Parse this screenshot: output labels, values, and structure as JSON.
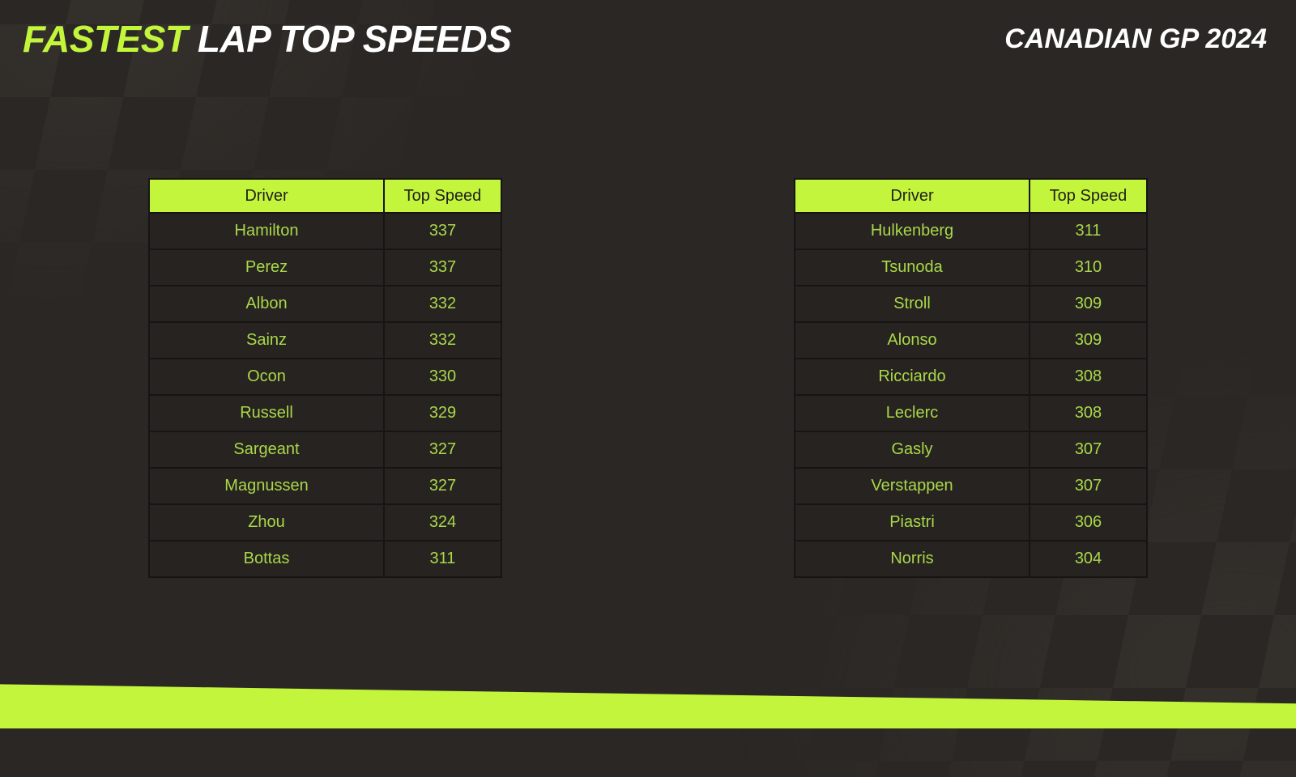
{
  "header": {
    "title_accent": "FASTEST",
    "title_plain": "LAP TOP SPEEDS",
    "subtitle": "CANADIAN GP 2024"
  },
  "theme": {
    "accent": "#c3f53c",
    "background": "#2a2724",
    "row_text": "#a9d84a",
    "border": "#171513",
    "header_text": "#22201d",
    "title_plain_color": "#ffffff"
  },
  "tables": [
    {
      "name": "left-speed-table",
      "columns": [
        "Driver",
        "Top Speed"
      ],
      "rows": [
        {
          "driver": "Hamilton",
          "speed": "337"
        },
        {
          "driver": "Perez",
          "speed": "337"
        },
        {
          "driver": "Albon",
          "speed": "332"
        },
        {
          "driver": "Sainz",
          "speed": "332"
        },
        {
          "driver": "Ocon",
          "speed": "330"
        },
        {
          "driver": "Russell",
          "speed": "329"
        },
        {
          "driver": "Sargeant",
          "speed": "327"
        },
        {
          "driver": "Magnussen",
          "speed": "327"
        },
        {
          "driver": "Zhou",
          "speed": "324"
        },
        {
          "driver": "Bottas",
          "speed": "311"
        }
      ]
    },
    {
      "name": "right-speed-table",
      "columns": [
        "Driver",
        "Top Speed"
      ],
      "rows": [
        {
          "driver": "Hulkenberg",
          "speed": "311"
        },
        {
          "driver": "Tsunoda",
          "speed": "310"
        },
        {
          "driver": "Stroll",
          "speed": "309"
        },
        {
          "driver": "Alonso",
          "speed": "309"
        },
        {
          "driver": "Ricciardo",
          "speed": "308"
        },
        {
          "driver": "Leclerc",
          "speed": "308"
        },
        {
          "driver": "Gasly",
          "speed": "307"
        },
        {
          "driver": "Verstappen",
          "speed": "307"
        },
        {
          "driver": "Piastri",
          "speed": "306"
        },
        {
          "driver": "Norris",
          "speed": "304"
        }
      ]
    }
  ],
  "chart_data": {
    "type": "table",
    "title": "FASTEST LAP TOP SPEEDS",
    "subtitle": "CANADIAN GP 2024",
    "xlabel": "Driver",
    "ylabel": "Top Speed",
    "categories": [
      "Hamilton",
      "Perez",
      "Albon",
      "Sainz",
      "Ocon",
      "Russell",
      "Sargeant",
      "Magnussen",
      "Zhou",
      "Bottas",
      "Hulkenberg",
      "Tsunoda",
      "Stroll",
      "Alonso",
      "Ricciardo",
      "Leclerc",
      "Gasly",
      "Verstappen",
      "Piastri",
      "Norris"
    ],
    "values": [
      337,
      337,
      332,
      332,
      330,
      329,
      327,
      327,
      324,
      311,
      311,
      310,
      309,
      309,
      308,
      308,
      307,
      307,
      306,
      304
    ],
    "ylim": [
      304,
      337
    ]
  }
}
